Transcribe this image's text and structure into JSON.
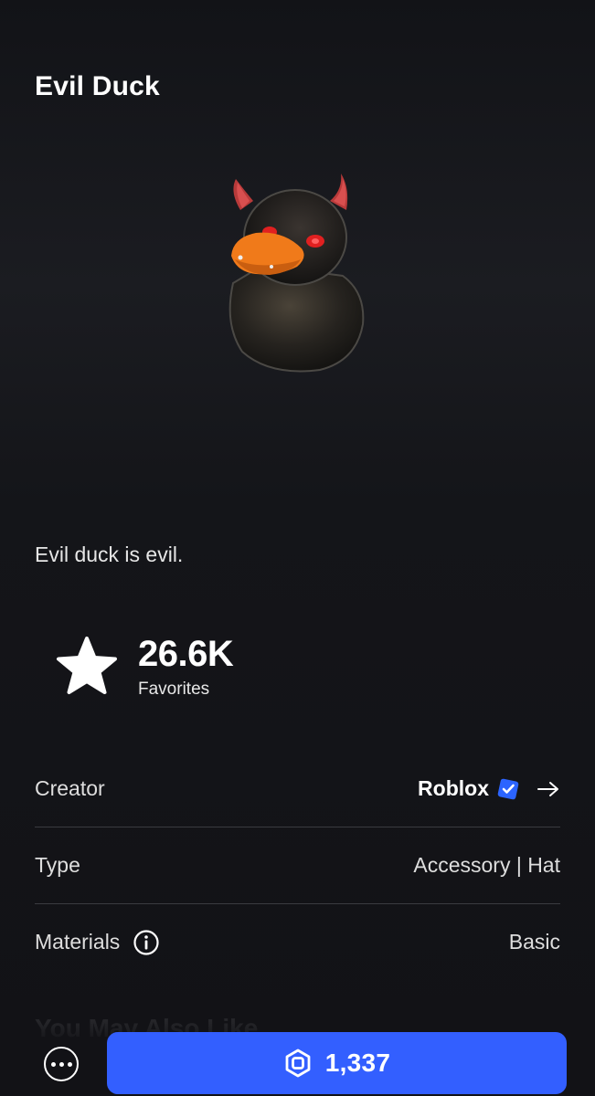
{
  "item": {
    "title": "Evil Duck",
    "description": "Evil duck is evil.",
    "thumbnail_icon": "evil-duck-thumbnail"
  },
  "favorites": {
    "count": "26.6K",
    "label": "Favorites",
    "icon": "star-icon"
  },
  "details": {
    "creator": {
      "label": "Creator",
      "value": "Roblox",
      "verified_icon": "verified-badge-icon",
      "arrow_icon": "arrow-right-icon"
    },
    "type": {
      "label": "Type",
      "value": "Accessory | Hat"
    },
    "materials": {
      "label": "Materials",
      "value": "Basic",
      "info_icon": "info-icon"
    }
  },
  "recommendations": {
    "heading": "You May Also Like"
  },
  "actions": {
    "more_icon": "more-options-icon",
    "buy": {
      "price": "1,337",
      "currency_icon": "robux-icon"
    }
  },
  "colors": {
    "background": "#121216",
    "buy_button": "#335fff",
    "verified_badge": "#2b64ff",
    "divider": "#3a3b40"
  }
}
